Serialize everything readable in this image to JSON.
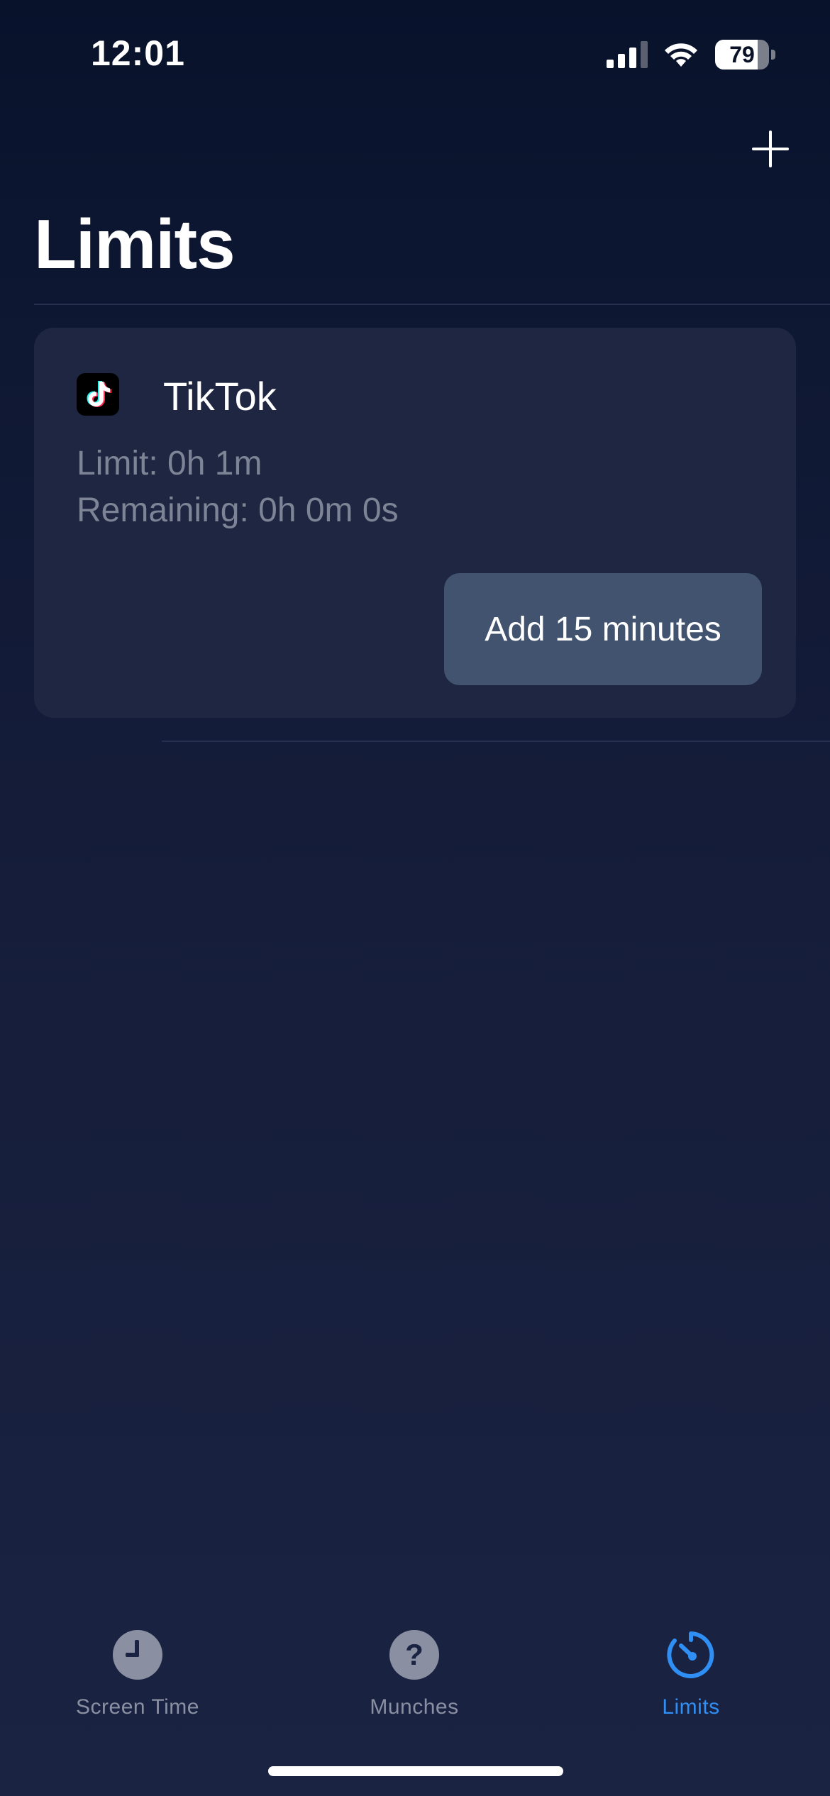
{
  "status_bar": {
    "time": "12:01",
    "battery_level": "79"
  },
  "header": {
    "title": "Limits",
    "add_icon": "plus-icon"
  },
  "limits": [
    {
      "app_name": "TikTok",
      "app_icon": "tiktok-icon",
      "limit_text": "Limit: 0h 1m",
      "remaining_text": "Remaining: 0h 0m 0s",
      "add_time_label": "Add 15 minutes"
    }
  ],
  "tab_bar": {
    "tabs": [
      {
        "label": "Screen Time",
        "icon": "clock-icon",
        "active": false
      },
      {
        "label": "Munches",
        "icon": "question-icon",
        "active": false
      },
      {
        "label": "Limits",
        "icon": "timer-icon",
        "active": true
      }
    ]
  },
  "colors": {
    "accent": "#2f8ff5",
    "card_background": "#1e2642",
    "button_background": "#41536f",
    "secondary_text": "#7d8496"
  }
}
